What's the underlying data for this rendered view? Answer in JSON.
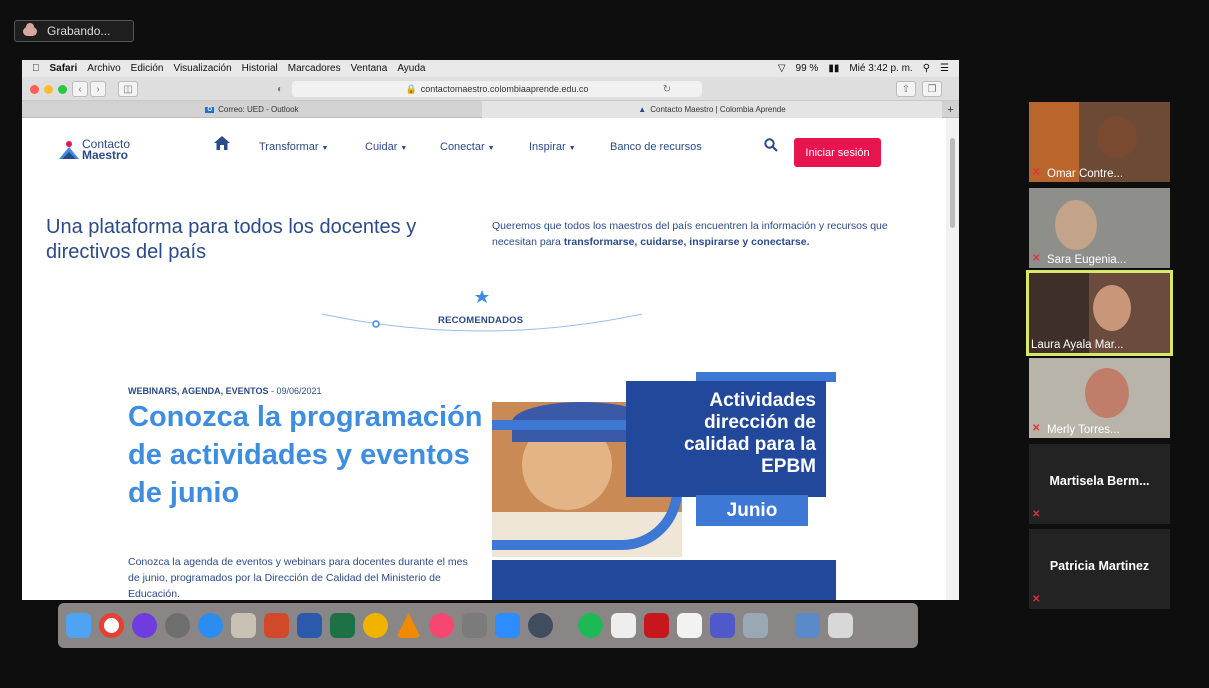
{
  "recording": {
    "label": "Grabando..."
  },
  "mac_menubar": {
    "app": "Safari",
    "items": [
      "Archivo",
      "Edición",
      "Visualización",
      "Historial",
      "Marcadores",
      "Ventana",
      "Ayuda"
    ],
    "battery": "99 %",
    "clock": "Mié 3:42 p. m."
  },
  "browser": {
    "url": "contactomaestro.colombiaaprende.edu.co",
    "tabs": [
      {
        "label": "Correo: UED - Outlook",
        "active": false
      },
      {
        "label": "Contacto Maestro | Colombia Aprende",
        "active": true
      }
    ]
  },
  "site": {
    "logo": {
      "line1": "Contacto",
      "line2": "Maestro"
    },
    "nav": [
      "Transformar",
      "Cuidar",
      "Conectar",
      "Inspirar",
      "Banco de recursos"
    ],
    "login_label": "Iniciar sesión",
    "hero_title": "Una plataforma para todos los docentes y directivos del país",
    "hero_sub_pre": "Queremos que todos los maestros del país encuentren la información y recursos que necesitan para ",
    "hero_sub_bold": "transformarse, cuidarse, inspirarse y conectarse.",
    "recommended_label": "RECOMENDADOS",
    "article": {
      "category": "WEBINARS, AGENDA, EVENTOS",
      "date": " - 09/06/2021",
      "title": "Conozca la programación de actividades y eventos de junio",
      "description": "Conozca la agenda de eventos y webinars para docentes durante el mes de junio, programados por la Dirección de Calidad del Ministerio de Educación."
    },
    "promo": {
      "line1": "Actividades",
      "line2": "dirección de",
      "line3": "calidad para la",
      "line4": "EPBM",
      "month": "Junio"
    }
  },
  "participants": [
    {
      "name": "Omar Contre...",
      "video": true,
      "muted": true
    },
    {
      "name": "Sara Eugenia...",
      "video": true,
      "muted": true
    },
    {
      "name": "Laura Ayala Mar...",
      "video": true,
      "muted": false,
      "active": true
    },
    {
      "name": "Merly Torres...",
      "video": true,
      "muted": true
    },
    {
      "name": "Martisela Berm...",
      "video": false,
      "muted": true
    },
    {
      "name": "Patricia Martinez",
      "video": false,
      "muted": true
    }
  ],
  "colors": {
    "brand_blue": "#2b4a8b",
    "accent_blue": "#3f8de0",
    "login_red": "#e8144f",
    "active_speaker": "#d7e86a"
  }
}
